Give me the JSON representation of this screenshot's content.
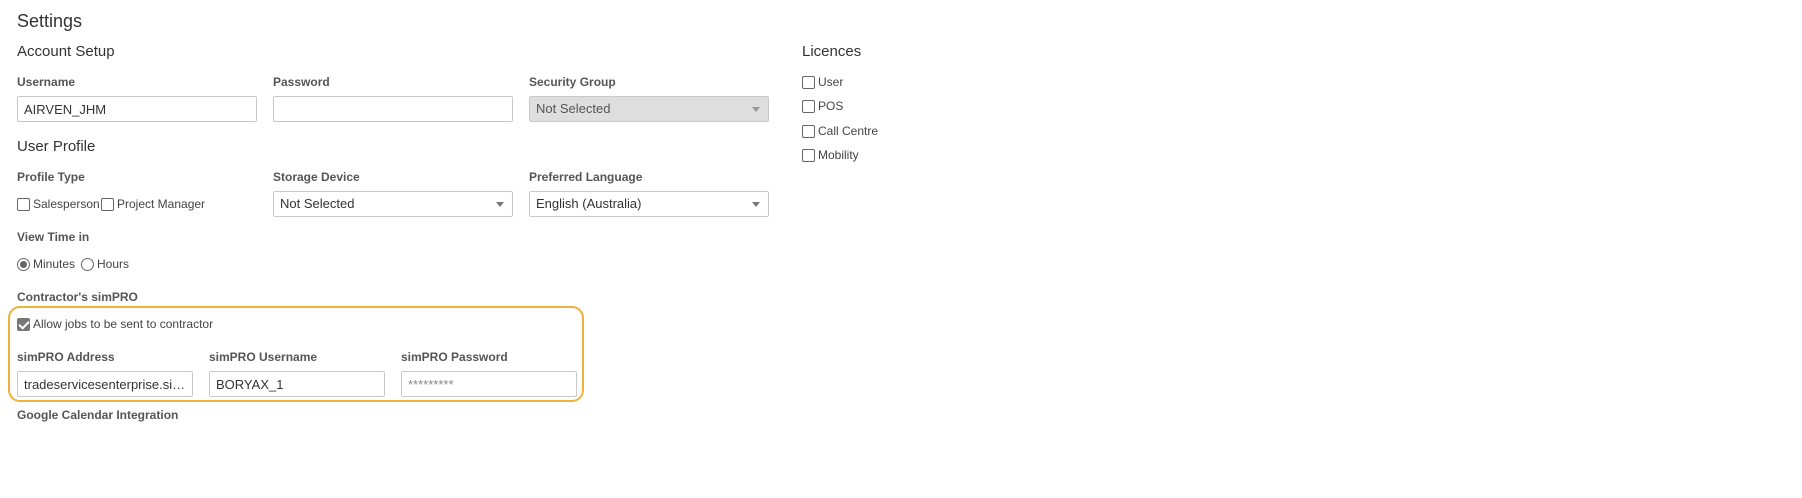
{
  "page": {
    "title": "Settings"
  },
  "account_setup": {
    "heading": "Account Setup",
    "username": {
      "label": "Username",
      "value": "AIRVEN_JHM"
    },
    "password": {
      "label": "Password",
      "value": ""
    },
    "security_group": {
      "label": "Security Group",
      "value": "Not Selected",
      "disabled": true
    }
  },
  "licences": {
    "heading": "Licences",
    "items": [
      {
        "label": "User",
        "checked": false
      },
      {
        "label": "POS",
        "checked": false
      },
      {
        "label": "Call Centre",
        "checked": false
      },
      {
        "label": "Mobility",
        "checked": false
      }
    ]
  },
  "user_profile": {
    "heading": "User Profile",
    "profile_type": {
      "label": "Profile Type",
      "options": [
        {
          "label": "Salesperson",
          "checked": false
        },
        {
          "label": "Project Manager",
          "checked": false
        }
      ]
    },
    "storage_device": {
      "label": "Storage Device",
      "value": "Not Selected"
    },
    "preferred_language": {
      "label": "Preferred Language",
      "value": "English (Australia)"
    },
    "view_time": {
      "label": "View Time in",
      "options": [
        {
          "label": "Minutes",
          "selected": true
        },
        {
          "label": "Hours",
          "selected": false
        }
      ]
    }
  },
  "contractor": {
    "label": "Contractor's simPRO",
    "allow_jobs": {
      "label": "Allow jobs to be sent to contractor",
      "checked": true
    },
    "address": {
      "label": "simPRO Address",
      "value": "tradeservicesenterprise.simpro..."
    },
    "username": {
      "label": "simPRO Username",
      "value": "BORYAX_1"
    },
    "password": {
      "label": "simPRO Password",
      "value": "*********"
    }
  },
  "google_calendar": {
    "label": "Google Calendar Integration"
  },
  "colors": {
    "highlight": "#f0b03c",
    "disabled_bg": "#dedede",
    "text": "#333333"
  }
}
